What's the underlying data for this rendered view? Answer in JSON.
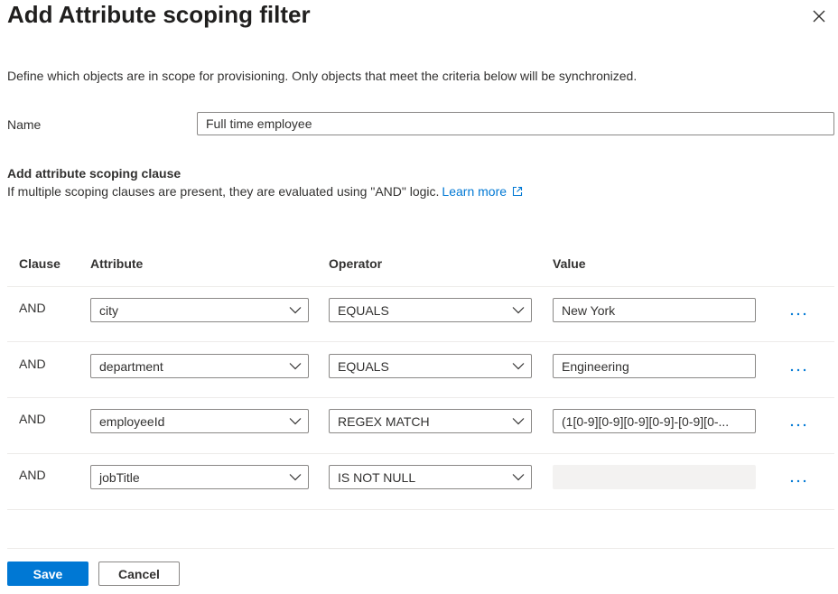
{
  "dialog": {
    "title": "Add Attribute scoping filter",
    "close_icon": "close-icon",
    "description": "Define which objects are in scope for provisioning. Only objects that meet the criteria below will be synchronized."
  },
  "name_field": {
    "label": "Name",
    "value": "Full time employee"
  },
  "scoping": {
    "title": "Add attribute scoping clause",
    "subtitle": "If multiple scoping clauses are present, they are evaluated using \"AND\" logic.",
    "learn_more": "Learn more",
    "learn_more_icon": "external-link-icon"
  },
  "table": {
    "headers": [
      "Clause",
      "Attribute",
      "Operator",
      "Value"
    ],
    "rows": [
      {
        "clause": "AND",
        "attribute": "city",
        "operator": "EQUALS",
        "value": "New York",
        "value_disabled": false
      },
      {
        "clause": "AND",
        "attribute": "department",
        "operator": "EQUALS",
        "value": "Engineering",
        "value_disabled": false
      },
      {
        "clause": "AND",
        "attribute": "employeeId",
        "operator": "REGEX MATCH",
        "value": "(1[0-9][0-9][0-9][0-9]-[0-9][0-...",
        "value_disabled": false
      },
      {
        "clause": "AND",
        "attribute": "jobTitle",
        "operator": "IS NOT NULL",
        "value": "",
        "value_disabled": true
      }
    ],
    "row_menu_icon": "more-icon"
  },
  "footer": {
    "save_label": "Save",
    "cancel_label": "Cancel"
  },
  "colors": {
    "accent": "#0078d4",
    "text": "#323130",
    "border": "#8a8886",
    "divider": "#edebe9",
    "disabled_fill": "#f3f2f1"
  }
}
